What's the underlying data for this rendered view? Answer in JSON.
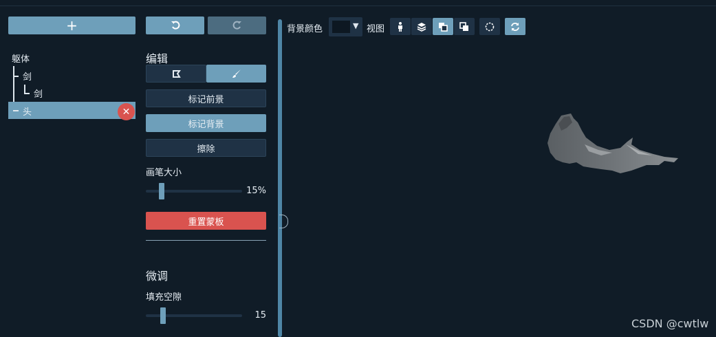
{
  "left": {
    "add_icon": "plus-icon",
    "tree": [
      {
        "label": "躯体"
      },
      {
        "label": "剑"
      },
      {
        "label": "剑"
      },
      {
        "label": "头",
        "selected": true
      }
    ],
    "delete_icon": "close-icon"
  },
  "edit": {
    "undo_icon": "undo-icon",
    "redo_icon": "redo-icon",
    "title": "编辑",
    "mode_icons": [
      "crop-icon",
      "brush-icon"
    ],
    "mark_foreground": "标记前景",
    "mark_background": "标记背景",
    "erase": "擦除",
    "brush_label": "画笔大小",
    "brush_value": "15%",
    "brush_level": 0.15,
    "reset_mask": "重置蒙板"
  },
  "tune": {
    "title": "微调",
    "fill_label": "填充空隙",
    "fill_value": "15"
  },
  "toolbar": {
    "bg_color_label": "背景颜色",
    "bg_color": "#0d1822",
    "view_label": "视图",
    "view_icons": [
      "person-icon",
      "layers-icon",
      "bring-front-icon",
      "send-back-icon"
    ],
    "circle_icon": "dashed-circle-icon",
    "refresh_icon": "refresh-icon"
  },
  "watermark": "CSDN @cwtlw",
  "colors": {
    "accent": "#6e9fba",
    "danger": "#d9534f",
    "panel": "#1f3245",
    "background": "#101c27"
  }
}
